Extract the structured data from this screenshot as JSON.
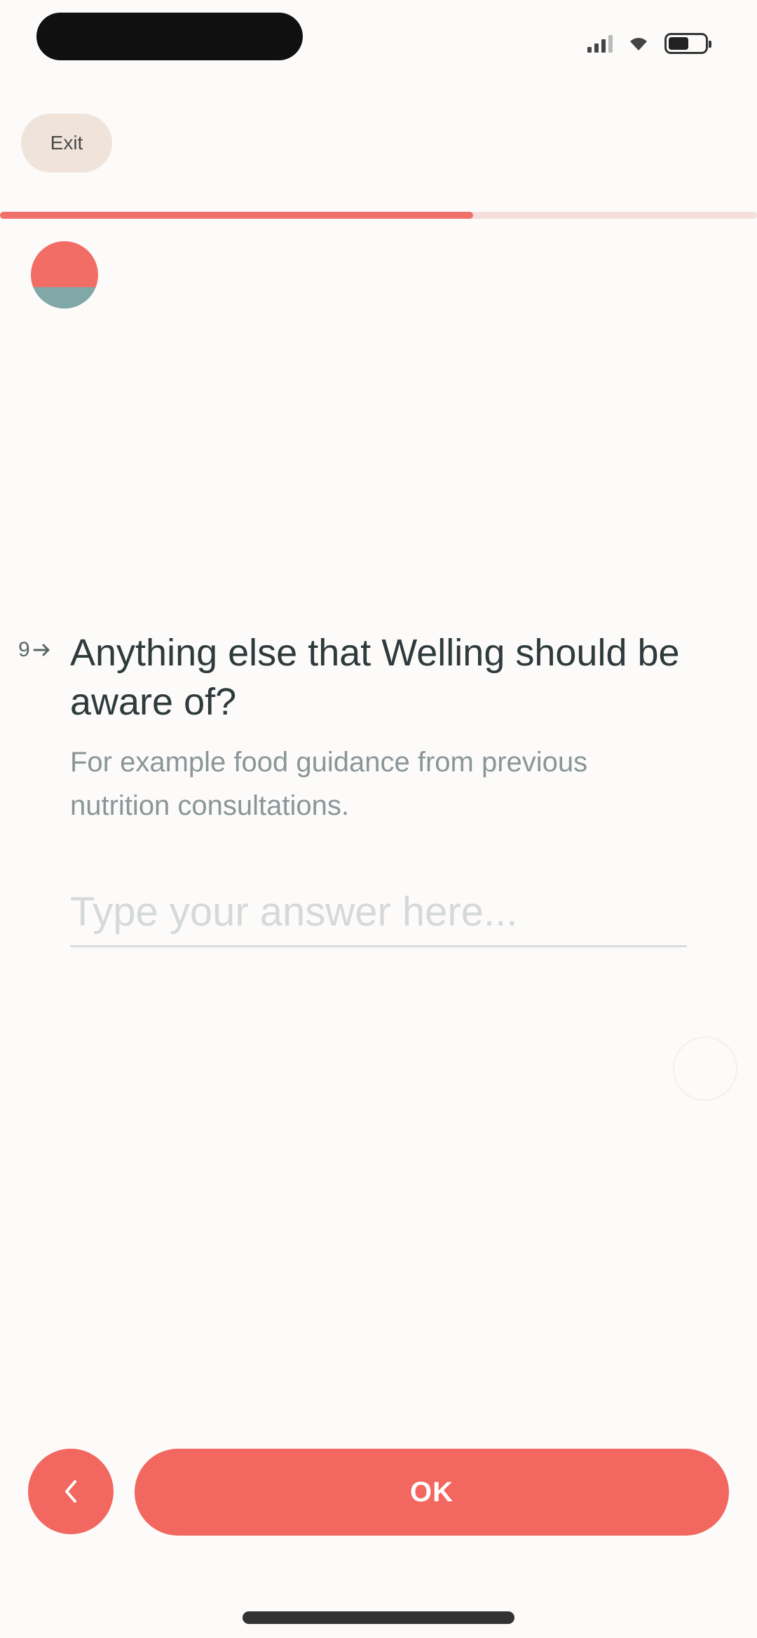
{
  "status_bar": {
    "pill_text": "",
    "pill_subtext": "",
    "icons": [
      "signal-icon",
      "wifi-icon",
      "battery-icon"
    ]
  },
  "header": {
    "exit_label": "Exit"
  },
  "progress": {
    "fraction": 0.625,
    "colors": {
      "fill": "#f0706a",
      "track": "#f6dedb"
    }
  },
  "avatar": {
    "icon": "avatar-logo"
  },
  "question": {
    "number": "9",
    "arrow_icon": "arrow-right-icon",
    "title": "Anything else that Welling should be aware of?",
    "description": "For example food guidance from previous nutrition consultations.",
    "input_placeholder": "Type your answer here...",
    "input_value": ""
  },
  "footer": {
    "back_icon": "chevron-left-icon",
    "ok_label": "OK"
  },
  "colors": {
    "accent": "#f2675f",
    "background": "#fcfbfa",
    "chip": "#f0e4da",
    "title_text": "#2e3a3c",
    "muted_text": "#8a9698"
  }
}
